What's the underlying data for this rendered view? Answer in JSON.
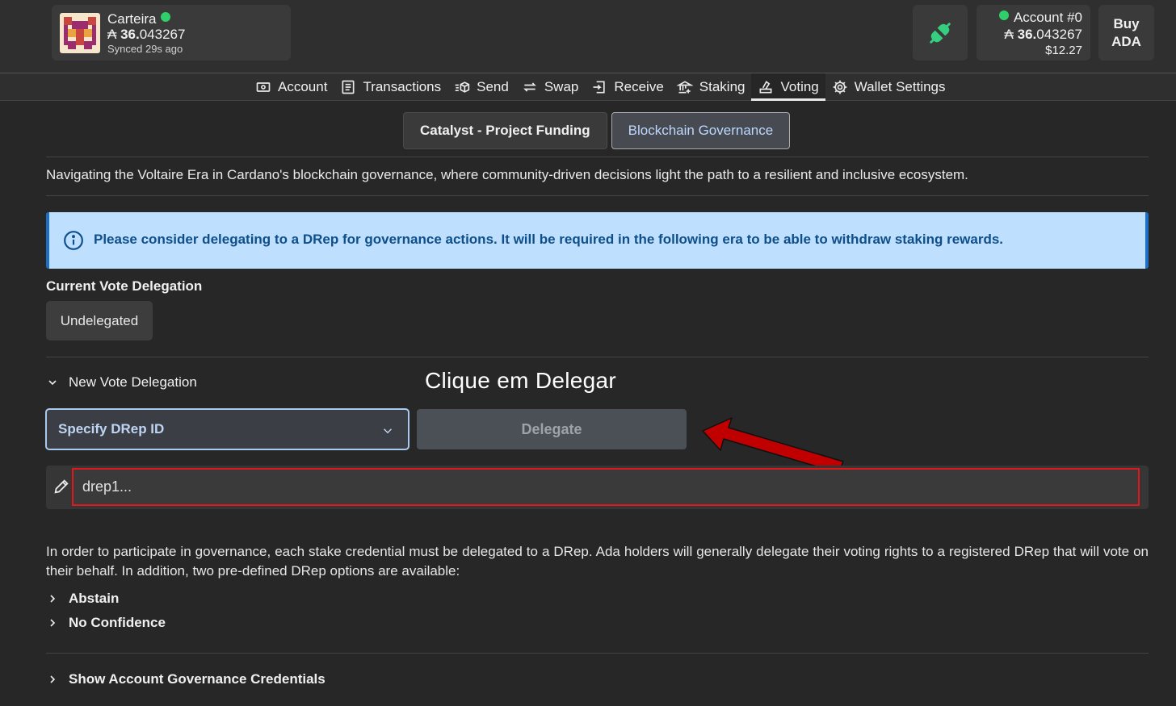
{
  "wallet": {
    "name": "Carteira",
    "balance_symbol": "₳",
    "balance_int": "36.",
    "balance_dec": "043267",
    "synced": "Synced 29s ago"
  },
  "account": {
    "label": "Account #0",
    "balance_symbol": "₳",
    "balance_int": "36.",
    "balance_dec": "043267",
    "usd": "$12.27"
  },
  "buy": {
    "line1": "Buy",
    "line2": "ADA"
  },
  "nav": [
    {
      "label": "Account",
      "icon": "account-icon"
    },
    {
      "label": "Transactions",
      "icon": "transactions-icon"
    },
    {
      "label": "Send",
      "icon": "send-icon"
    },
    {
      "label": "Swap",
      "icon": "swap-icon"
    },
    {
      "label": "Receive",
      "icon": "receive-icon"
    },
    {
      "label": "Staking",
      "icon": "staking-icon"
    },
    {
      "label": "Voting",
      "icon": "voting-icon",
      "active": true
    },
    {
      "label": "Wallet Settings",
      "icon": "gear-icon"
    }
  ],
  "subtabs": [
    {
      "label": "Catalyst - Project Funding"
    },
    {
      "label": "Blockchain Governance",
      "active": true
    }
  ],
  "intro": "Navigating the Voltaire Era in Cardano's blockchain governance, where community-driven decisions light the path to a resilient and inclusive ecosystem.",
  "info": "Please consider delegating to a DRep for governance actions. It will be required in the following era to be able to withdraw staking rewards.",
  "current_delegation": {
    "label": "Current Vote Delegation",
    "value": "Undelegated"
  },
  "new_delegation": {
    "label": "New Vote Delegation",
    "select_value": "Specify DRep ID",
    "delegate_label": "Delegate",
    "input_placeholder": "drep1..."
  },
  "annotation": "Clique em Delegar",
  "paragraph": "In order to participate in governance, each stake credential must be delegated to a DRep. Ada holders will generally delegate their voting rights to a registered DRep that will vote on their behalf. In addition, two pre-defined DRep options are available:",
  "options": [
    "Abstain",
    "No Confidence"
  ],
  "show_credentials": "Show Account Governance Credentials",
  "colors": {
    "background": "#272727",
    "info_bg": "#bfdfff",
    "info_text": "#0e4f8a",
    "synced_dot": "#2fd06a",
    "annotation_red": "#c00000"
  }
}
